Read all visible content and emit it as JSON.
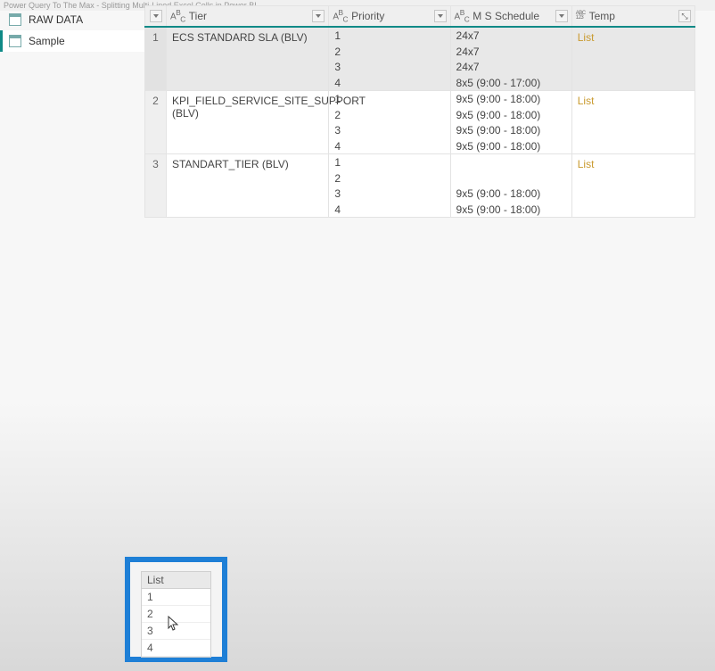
{
  "window_title": "Power Query To The Max - Splitting Multi-Lined Excel Cells in Power BI",
  "sidebar": {
    "items": [
      {
        "label": "RAW DATA"
      },
      {
        "label": "Sample"
      }
    ]
  },
  "table": {
    "columns": {
      "tier": {
        "type": "A_C",
        "label": "Tier"
      },
      "priority": {
        "type": "A_C",
        "label": "Priority"
      },
      "schedule": {
        "type": "A_C",
        "label": "M S Schedule"
      },
      "temp": {
        "type": "ABC123",
        "label": "Temp"
      }
    },
    "rows": [
      {
        "n": "1",
        "tier": "ECS STANDARD SLA (BLV)",
        "priority": [
          "1",
          "2",
          "3",
          "4"
        ],
        "schedule": [
          "24x7",
          "24x7",
          "24x7",
          "8x5 (9:00 - 17:00)"
        ],
        "temp": "List"
      },
      {
        "n": "2",
        "tier": "KPI_FIELD_SERVICE_SITE_SUPPORT (BLV)",
        "priority": [
          "1",
          "2",
          "3",
          "4"
        ],
        "schedule": [
          "9x5 (9:00 - 18:00)",
          "9x5 (9:00 - 18:00)",
          "9x5 (9:00 - 18:00)",
          "9x5 (9:00 - 18:00)"
        ],
        "temp": "List"
      },
      {
        "n": "3",
        "tier": "STANDART_TIER (BLV)",
        "priority": [
          "1",
          "2",
          "3",
          "4"
        ],
        "schedule": [
          "",
          "",
          "9x5 (9:00 - 18:00)",
          "9x5 (9:00 - 18:00)"
        ],
        "temp": "List"
      }
    ]
  },
  "preview": {
    "header": "List",
    "items": [
      "1",
      "2",
      "3",
      "4"
    ]
  }
}
